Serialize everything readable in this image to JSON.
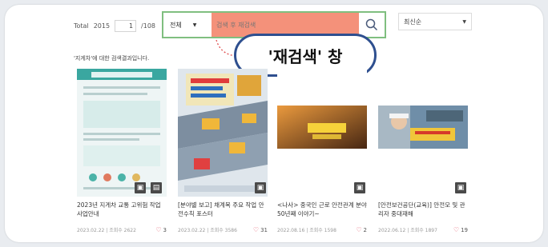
{
  "toolbar": {
    "total_label": "Total",
    "total_count": "2015",
    "page_current": "1",
    "page_total": "/108",
    "scope_selected": "전체",
    "search_placeholder": "검색 후 재검색",
    "sort_selected": "최신순"
  },
  "callout": {
    "label": "'재검색' 창"
  },
  "result_text": "'지게차'에 대한 검색결과입니다.",
  "colors": {
    "search_border": "#7fbf7f",
    "search_fill": "#f4917a",
    "callout_border": "#2e4f8f",
    "callout_dots": "#e05050"
  },
  "items": [
    {
      "title": "2023년 지게차 교통 고위험 작업 사업안내",
      "meta": "2023.02.22 | 조회수 2622",
      "likes": "3",
      "thumb": "doc"
    },
    {
      "title": "[분야별 보고] 채계목 주요 작업 안전수칙 포스터",
      "meta": "2023.02.22 | 조회수 3586",
      "likes": "31",
      "thumb": "poster"
    },
    {
      "title": "<나사> 중국인 근로 안전관계 분야 50년째 이야기~",
      "meta": "2022.08.16 | 조회수 1598",
      "likes": "2",
      "thumb": "video"
    },
    {
      "title": "[안전보건공단(교육)] 안전모 및 관리자 중대재해",
      "meta": "2022.06.12 | 조회수 1897",
      "likes": "19",
      "thumb": "video2"
    }
  ],
  "icons": {
    "search": "magnifier-icon",
    "caret": "chevron-down-icon",
    "like": "heart-icon",
    "bookmark": "bookmark-icon",
    "share": "share-icon"
  }
}
